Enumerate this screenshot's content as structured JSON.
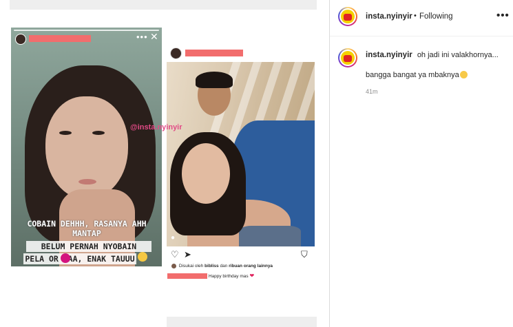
{
  "media": {
    "story": {
      "watermark": "@insta.nyinyir",
      "caption_line1": "COBAIN DEHHH, RASANYA AHH",
      "caption_line2": "MANTAP",
      "caption_line3": "BELUM PERNAH NYOBAIN",
      "caption_line4": "PELA  OR YAA, ENAK TAUUU",
      "dots": "•••",
      "close": "✕"
    },
    "post": {
      "likes_prefix": "Disukai oleh",
      "likes_user": "bibliss",
      "likes_mid": "dan",
      "likes_rest": "ribuan orang lainnya",
      "caption": "Happy birthday mas",
      "heart": "❤",
      "icons": {
        "like": "♡",
        "share": "➤",
        "save": "⛉"
      }
    }
  },
  "header": {
    "username": "insta.nyinyir",
    "separator": "•",
    "follow_state": "Following",
    "more": "•••"
  },
  "comment": {
    "username": "insta.nyinyir",
    "line1": "oh jadi ini valakhornya...",
    "line2": "bangga bangat ya mbaknya",
    "time": "41m"
  }
}
